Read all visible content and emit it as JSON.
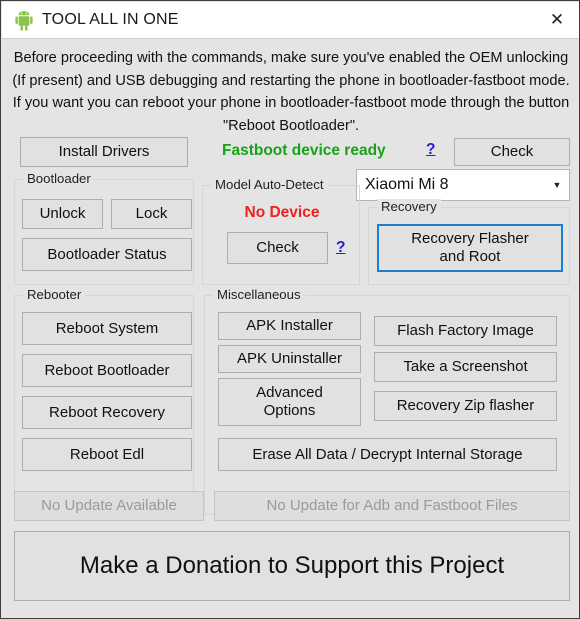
{
  "window": {
    "title": "TOOL ALL IN ONE",
    "icon": "android-robot-icon",
    "close_label": "✕"
  },
  "notice": {
    "text": "Before proceeding with the commands, make sure you've enabled the OEM unlocking (If present) and USB debugging and restarting the phone in bootloader-fastboot mode. If you want you can reboot your phone in bootloader-fastboot mode through the button \"Reboot Bootloader\"."
  },
  "top_row": {
    "install_drivers": "Install Drivers",
    "fastboot_status": "Fastboot device ready",
    "fastboot_help": "?",
    "check": "Check"
  },
  "device_combo": {
    "value": "Xiaomi Mi 8",
    "arrow": "▼"
  },
  "bootloader": {
    "legend": "Bootloader",
    "unlock": "Unlock",
    "lock": "Lock",
    "status": "Bootloader Status"
  },
  "model_auto_detect": {
    "legend": "Model Auto-Detect",
    "status": "No Device",
    "check": "Check",
    "help": "?"
  },
  "recovery": {
    "legend": "Recovery",
    "flasher_button": "Recovery Flasher\nand Root"
  },
  "rebooter": {
    "legend": "Rebooter",
    "buttons": [
      "Reboot System",
      "Reboot Bootloader",
      "Reboot Recovery",
      "Reboot Edl"
    ]
  },
  "miscellaneous": {
    "legend": "Miscellaneous",
    "left_buttons": [
      "APK Installer",
      "APK Uninstaller",
      "Advanced\nOptions"
    ],
    "right_buttons": [
      "Flash Factory Image",
      "Take a Screenshot",
      "Recovery Zip flasher"
    ],
    "erase_button": "Erase All Data / Decrypt Internal Storage"
  },
  "updates": {
    "app_update": "No Update Available",
    "files_update": "No Update for Adb and Fastboot Files"
  },
  "donation": {
    "label": "Make a Donation to Support this Project"
  },
  "colors": {
    "ready_green": "#17a317",
    "error_red": "#f02020",
    "link_blue": "#2222cc",
    "focus_blue": "#1d7fd1",
    "window_bg": "#e4e4e4",
    "button_bg": "#e1e1e1"
  }
}
